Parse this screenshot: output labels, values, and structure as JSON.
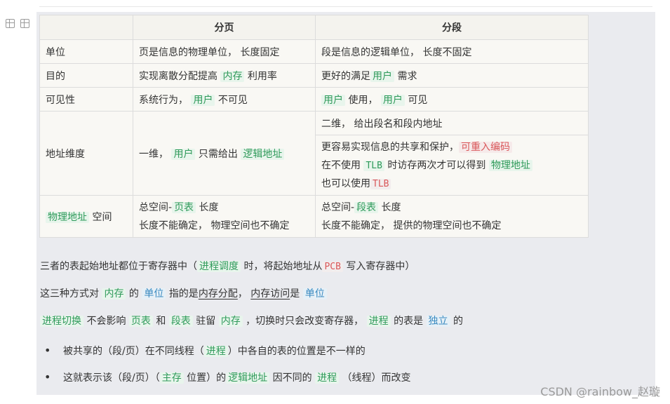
{
  "table": {
    "headers": [
      "",
      "分页",
      "分段"
    ],
    "rows": {
      "unit": {
        "label": "单位",
        "page": "页是信息的物理单位， 长度固定",
        "seg": "段是信息的逻辑单位， 长度不固定"
      },
      "purpose": {
        "label": "目的",
        "page_a": "实现离散分配提高",
        "page_hl": "内存",
        "page_b": "利用率",
        "seg_a": "更好的满足",
        "seg_hl": "用户",
        "seg_b": "需求"
      },
      "visibility": {
        "label": "可见性",
        "page_a": "系统行为，",
        "page_hl": "用户",
        "page_b": "不可见",
        "seg_hl1": "用户",
        "seg_a": "使用，",
        "seg_hl2": "用户",
        "seg_b": "可见"
      },
      "dimension": {
        "label": "地址维度",
        "page_a": "一维，",
        "page_hl1": "用户",
        "page_b": "只需给出",
        "page_hl2": "逻辑地址",
        "seg_top": "二维， 给出段名和段内地址",
        "seg_l1_a": "更容易实现信息的共享和保护，",
        "seg_l1_hl": "可重入编码",
        "seg_l2_a": "在不使用",
        "seg_l2_hl1": "TLB",
        "seg_l2_b": "时访存两次才可以得到",
        "seg_l2_hl2": "物理地址",
        "seg_l3_a": "也可以使用",
        "seg_l3_hl": "TLB"
      },
      "space": {
        "label_hl": "物理地址",
        "label_b": "空间",
        "page_l1_a": "总空间-",
        "page_l1_hl": "页表",
        "page_l1_b": "长度",
        "page_l2": "长度不能确定， 物理空间也不确定",
        "seg_l1_a": "总空间-",
        "seg_l1_hl": "段表",
        "seg_l1_b": "长度",
        "seg_l2": "长度不能确定， 提供的物理空间也不确定"
      }
    }
  },
  "paragraphs": {
    "p1": {
      "a": "三者的表起始地址都位于寄存器中（",
      "hl1": "进程调度",
      "b": "时，将起始地址从",
      "hl2": "PCB",
      "c": "写入寄存器中）"
    },
    "p2": {
      "a": "这三种方式对",
      "hl1": "内存",
      "b": "的",
      "hl2": "单位",
      "c": "指的是",
      "u1": "内存分配",
      "d": "，",
      "u2": "内存访问",
      "e": "是",
      "hl3": "单位"
    },
    "p3": {
      "hl1": "进程切换",
      "a": "不会影响",
      "hl2": "页表",
      "b": "和",
      "hl3": "段表",
      "c": "驻留",
      "hl4": "内存",
      "d": "，切换时只会改变寄存器，",
      "hl5": "进程",
      "e": "的表是",
      "hl6": "独立",
      "f": "的"
    }
  },
  "bullets": {
    "b1": {
      "a": "被共享的（段/页）在不同线程（",
      "hl": "进程",
      "b": "）中各自的表的位置是不一样的"
    },
    "b2": {
      "a": "这就表示该（段/页）（",
      "hl1": "主存",
      "b": "位置）的",
      "hl2": "逻辑地址",
      "c": "因不同的",
      "hl3": "进程",
      "d": "（线程）而改变"
    }
  },
  "watermark": "CSDN @rainbow_赵璇",
  "colors": {
    "highlight_green": "#2f9a5a",
    "highlight_red": "#d9585a",
    "highlight_blue": "#3a8ac0",
    "panel_bg": "#eaebef"
  },
  "icons": [
    "table-layout-icon",
    "table-grid-icon"
  ]
}
